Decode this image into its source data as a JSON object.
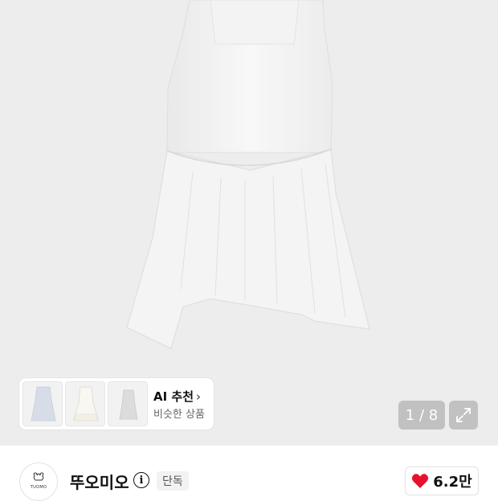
{
  "product": {
    "image_alt": "white sleeveless dress",
    "page_current": "1",
    "page_total": "8",
    "page_indicator": "1 / 8"
  },
  "ai_recommend": {
    "title": "AI 추천",
    "subtitle": "비슷한 상품",
    "chevron_icon": "chevron-right-icon",
    "thumbnails": [
      {
        "name": "blue-dress"
      },
      {
        "name": "white-ruffle-dress"
      },
      {
        "name": "gray-slip-dress"
      }
    ]
  },
  "brand": {
    "logo_text": "TUOMO",
    "name": "뚜오미오",
    "badge": "단독",
    "info_icon": "info-icon"
  },
  "like": {
    "icon": "heart-icon",
    "count": "6.2만",
    "color": "#e8112d"
  }
}
